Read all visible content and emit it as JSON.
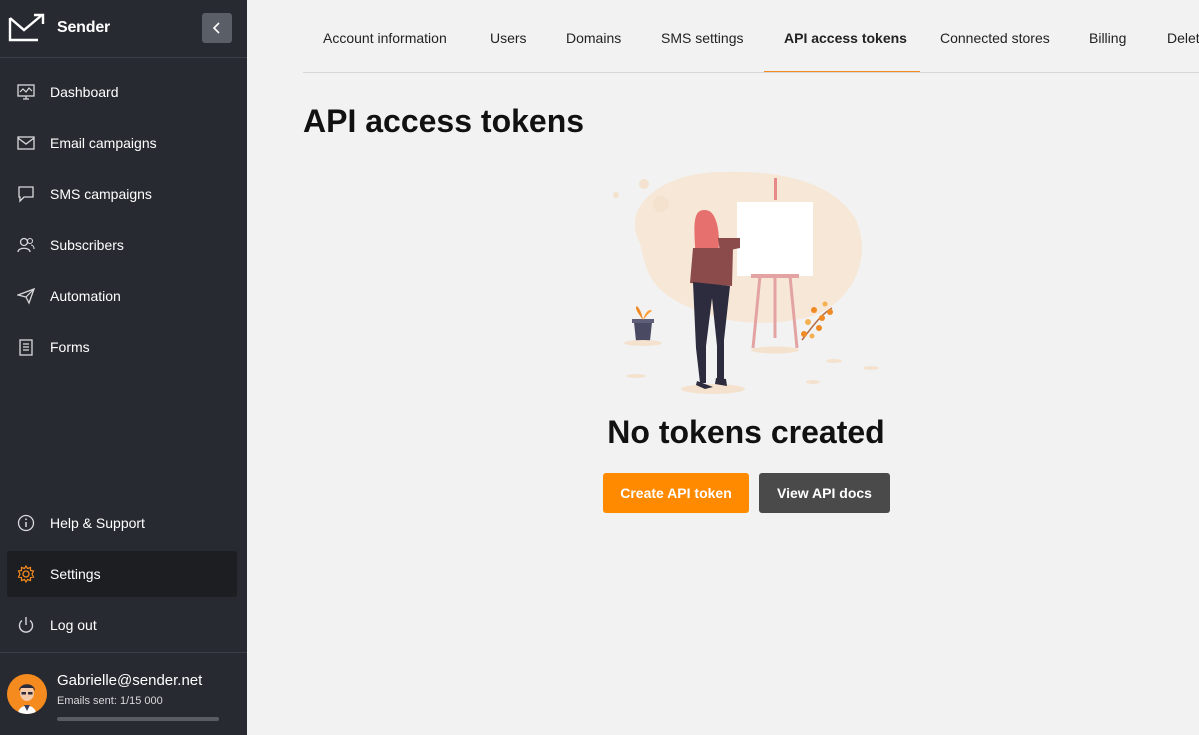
{
  "brand": {
    "name": "Sender"
  },
  "sidebar": {
    "collapse_icon": "chevron-left-icon",
    "nav": [
      {
        "label": "Dashboard",
        "icon": "monitor-icon"
      },
      {
        "label": "Email campaigns",
        "icon": "envelope-icon"
      },
      {
        "label": "SMS campaigns",
        "icon": "chat-bubble-icon"
      },
      {
        "label": "Subscribers",
        "icon": "users-icon"
      },
      {
        "label": "Automation",
        "icon": "paper-plane-icon"
      },
      {
        "label": "Forms",
        "icon": "clipboard-icon"
      }
    ],
    "bottom_nav": [
      {
        "label": "Help & Support",
        "icon": "info-icon"
      },
      {
        "label": "Settings",
        "icon": "gear-icon",
        "active": true
      },
      {
        "label": "Log out",
        "icon": "power-icon"
      }
    ],
    "user": {
      "email": "Gabrielle@sender.net",
      "emails_sent": "Emails sent: 1/15 000",
      "sent_fraction": 0.0001
    }
  },
  "tabs": [
    {
      "label": "Account information"
    },
    {
      "label": "Users"
    },
    {
      "label": "Domains"
    },
    {
      "label": "SMS settings"
    },
    {
      "label": "API access tokens",
      "active": true
    },
    {
      "label": "Connected stores"
    },
    {
      "label": "Billing"
    },
    {
      "label": "Delete"
    }
  ],
  "main": {
    "title": "API access tokens",
    "empty_state": {
      "title": "No tokens created",
      "primary_button": "Create API token",
      "secondary_button": "View API docs"
    }
  },
  "colors": {
    "accent": "#ff8a00",
    "sidebar_bg": "#272a31",
    "page_bg": "#f2f2f2",
    "secondary_button": "#4a4a4a"
  }
}
